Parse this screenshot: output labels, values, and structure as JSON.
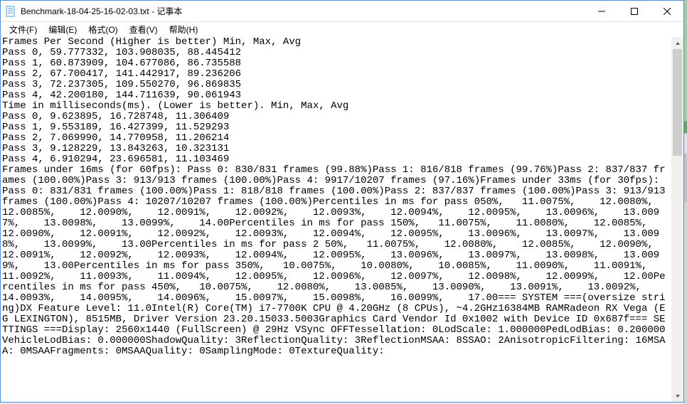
{
  "window": {
    "title": "Benchmark-18-04-25-16-02-03.txt - 记事本"
  },
  "menu": {
    "file": "文件(F)",
    "edit": "编辑(E)",
    "format": "格式(O)",
    "view": "查看(V)",
    "help": "帮助(H)"
  },
  "body_text": "Frames Per Second (Higher is better) Min, Max, Avg\nPass 0, 59.777332, 103.908035, 88.445412\nPass 1, 60.873909, 104.677086, 86.735588\nPass 2, 67.700417, 141.442917, 89.236206\nPass 3, 72.237305, 109.550270, 96.869835\nPass 4, 42.200180, 144.711639, 90.061943\nTime in milliseconds(ms). (Lower is better). Min, Max, Avg\nPass 0, 9.623895, 16.728748, 11.306409\nPass 1, 9.553189, 16.427399, 11.529293\nPass 2, 7.069990, 14.770958, 11.206214\nPass 3, 9.128229, 13.843263, 10.323131\nPass 4, 6.910294, 23.696581, 11.103469\nFrames under 16ms (for 60fps): Pass 0: 830/831 frames (99.88%)Pass 1: 816/818 frames (99.76%)Pass 2: 837/837 frames (100.00%)Pass 3: 913/913 frames (100.00%)Pass 4: 9917/10207 frames (97.16%)Frames under 33ms (for 30fps): Pass 0: 831/831 frames (100.00%)Pass 1: 818/818 frames (100.00%)Pass 2: 837/837 frames (100.00%)Pass 3: 913/913 frames (100.00%)Pass 4: 10207/10207 frames (100.00%)Percentiles in ms for pass 050%,   11.0075%,    12.0080%,    12.0085%,    12.0090%,    12.0091%,    12.0092%,    12.0093%,    12.0094%,    12.0095%,    13.0096%,    13.0097%,    13.0098%,    13.0099%,    14.00Percentiles in ms for pass 150%,   11.0075%,    11.0080%,    12.0085%,    12.0090%,    12.0091%,    12.0092%,    12.0093%,    12.0094%,    12.0095%,    13.0096%,    13.0097%,    13.0098%,    13.0099%,    13.00Percentiles in ms for pass 2 50%,   11.0075%,    12.0080%,    12.0085%,    12.0090%,    12.0091%,    12.0092%,    12.0093%,    12.0094%,    12.0095%,    13.0096%,    13.0097%,    13.0098%,    13.0099%,    13.00Percentiles in ms for pass 350%,   10.0075%,    10.0080%,    10.0085%,    11.0090%,    11.0091%,    11.0092%,    11.0093%,    11.0094%,    12.0095%,    12.0096%,    12.0097%,    12.0098%,    12.0099%,    12.00Percentiles in ms for pass 450%,   10.0075%,    12.0080%,    13.0085%,    13.0090%,    13.0091%,    13.0092%,    14.0093%,    14.0095%,    14.0096%,    15.0097%,    15.0098%,    16.0099%,    17.00=== SYSTEM ===(oversize string)DX Feature Level: 11.0Intel(R) Core(TM) i7-7700K CPU @ 4.20GHz (8 CPUs), ~4.2GHz16384MB RAMRadeon RX Vega (EG LEXINGTON), 8515MB, Driver Version 23.20.15033.5003Graphics Card Vendor Id 0x1002 with Device ID 0x687f=== SETTINGS ===Display: 2560x1440 (FullScreen) @ 29Hz VSync OFFTessellation: 0LodScale: 1.000000PedLodBias: 0.200000VehicleLodBias: 0.000000ShadowQuality: 3ReflectionQuality: 3ReflectionMSAA: 8SSAO: 2AnisotropicFiltering: 16MSAA: 0MSAAFragments: 0MSAAQuality: 0SamplingMode: 0TextureQuality:"
}
